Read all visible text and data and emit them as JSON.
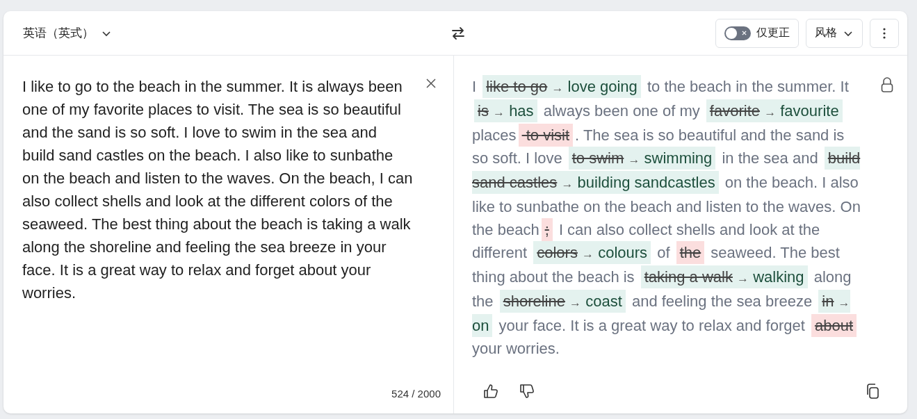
{
  "header": {
    "language": "英语（英式）",
    "toggle": {
      "label": "仅更正",
      "on": false
    },
    "style_button": "风格"
  },
  "input": {
    "text": "I like to go to the beach in the summer. It is always been one of my favorite places to visit. The sea is so beautiful and the sand is so soft. I love to swim in the sea and build sand castles on the beach. I also like to sunbathe on the beach and listen to the waves. On the beach, I can also collect shells and look at the different colors of the seaweed. The best thing about the beach is taking a walk along the shoreline and feeling the sea breeze in your face. It is a great way to relax and forget about your worries.",
    "count": "524 / 2000"
  },
  "output": {
    "segments": [
      {
        "kind": "text",
        "text": "I "
      },
      {
        "kind": "replace",
        "old": "like to go",
        "arrow": "→",
        "new": "love going"
      },
      {
        "kind": "text",
        "text": " to the beach in the summer. It "
      },
      {
        "kind": "replace",
        "old": "is",
        "arrow": "→",
        "new": "has"
      },
      {
        "kind": "text",
        "text": " always been one of my "
      },
      {
        "kind": "replace",
        "old": "favorite",
        "arrow": "→",
        "new": "favourite"
      },
      {
        "kind": "text",
        "text": " places"
      },
      {
        "kind": "delete",
        "old": " to visit"
      },
      {
        "kind": "text",
        "text": ". The sea is so beautiful and the sand is so soft. I love "
      },
      {
        "kind": "replace",
        "old": "to swim",
        "arrow": "→",
        "new": "swimming"
      },
      {
        "kind": "text",
        "text": " in the sea and "
      },
      {
        "kind": "replace",
        "old": "build sand castles",
        "arrow": "→",
        "new": "building sandcastles"
      },
      {
        "kind": "text",
        "text": " on the beach. I also like to sunbathe on the beach and listen to the waves. On the beach"
      },
      {
        "kind": "delete",
        "old": ";"
      },
      {
        "kind": "text",
        "text": " I can also collect shells and look at the different "
      },
      {
        "kind": "replace",
        "old": "colors",
        "arrow": "→",
        "new": "colours"
      },
      {
        "kind": "text",
        "text": " of "
      },
      {
        "kind": "delete",
        "old": "the"
      },
      {
        "kind": "text",
        "text": " seaweed. The best thing about the beach is "
      },
      {
        "kind": "replace",
        "old": "taking a walk",
        "arrow": "→",
        "new": "walking"
      },
      {
        "kind": "text",
        "text": " along the "
      },
      {
        "kind": "replace",
        "old": "shoreline",
        "arrow": "→",
        "new": "coast"
      },
      {
        "kind": "text",
        "text": " and feeling the sea breeze "
      },
      {
        "kind": "replace",
        "old": "in",
        "arrow": "→",
        "new": "on"
      },
      {
        "kind": "text",
        "text": " your face. It is a great way to relax and forget "
      },
      {
        "kind": "delete",
        "old": "about"
      },
      {
        "kind": "text",
        "text": " your worries."
      }
    ]
  }
}
